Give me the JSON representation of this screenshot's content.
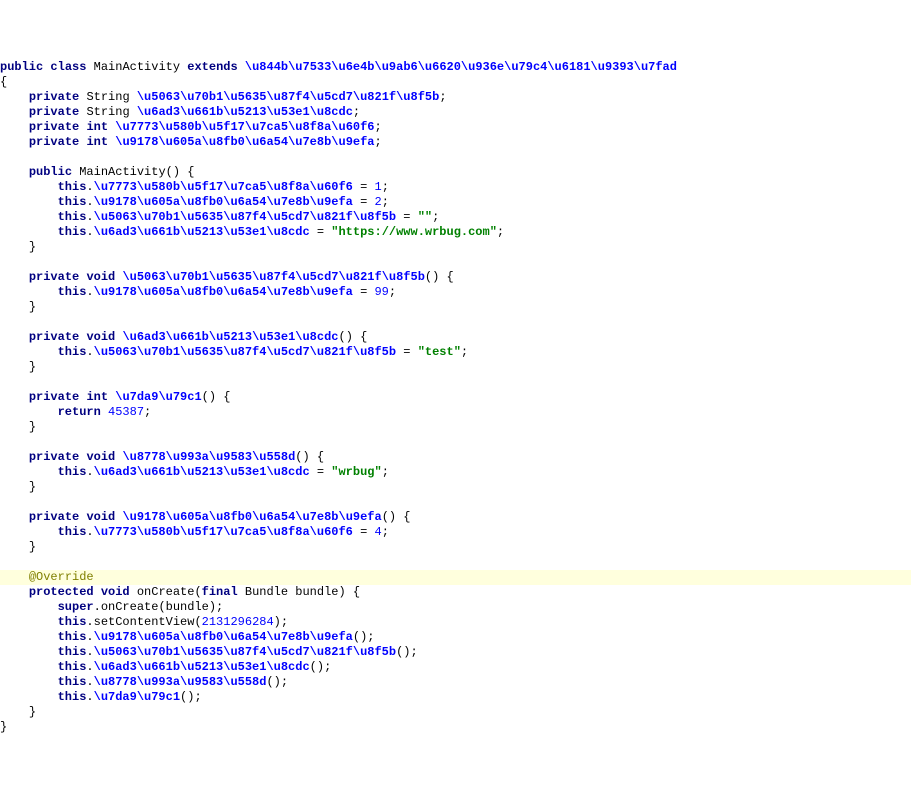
{
  "code": {
    "l1": {
      "kw1": "public",
      "kw2": "class",
      "name": "MainActivity",
      "kw3": "extends",
      "ext": "\\u844b\\u7533\\u6e4b\\u9ab6\\u6620\\u936e\\u79c4\\u6181\\u9393\\u7fad"
    },
    "l2": {
      "text": "{"
    },
    "l3": {
      "kw1": "private",
      "type": "String",
      "id": "\\u5063\\u70b1\\u5635\\u87f4\\u5cd7\\u821f\\u8f5b"
    },
    "l4": {
      "kw1": "private",
      "type": "String",
      "id": "\\u6ad3\\u661b\\u5213\\u53e1\\u8cdc"
    },
    "l5": {
      "kw1": "private",
      "kw2": "int",
      "id": "\\u7773\\u580b\\u5f17\\u7ca5\\u8f8a\\u60f6"
    },
    "l6": {
      "kw1": "private",
      "kw2": "int",
      "id": "\\u9178\\u605a\\u8fb0\\u6a54\\u7e8b\\u9efa"
    },
    "l8": {
      "kw1": "public",
      "name": "MainActivity",
      "suffix": "() {"
    },
    "l9": {
      "kw1": "this",
      "dot": ".",
      "id": "\\u7773\\u580b\\u5f17\\u7ca5\\u8f8a\\u60f6",
      "eq": " = ",
      "val": "1",
      "semi": ";"
    },
    "l10": {
      "kw1": "this",
      "dot": ".",
      "id": "\\u9178\\u605a\\u8fb0\\u6a54\\u7e8b\\u9efa",
      "eq": " = ",
      "val": "2",
      "semi": ";"
    },
    "l11": {
      "kw1": "this",
      "dot": ".",
      "id": "\\u5063\\u70b1\\u5635\\u87f4\\u5cd7\\u821f\\u8f5b",
      "eq": " = ",
      "val": "\"\"",
      "semi": ";"
    },
    "l12": {
      "kw1": "this",
      "dot": ".",
      "id": "\\u6ad3\\u661b\\u5213\\u53e1\\u8cdc",
      "eq": " = ",
      "val": "\"https://www.wrbug.com\"",
      "semi": ";"
    },
    "l13": {
      "text": "}"
    },
    "l15": {
      "kw1": "private",
      "kw2": "void",
      "id": "\\u5063\\u70b1\\u5635\\u87f4\\u5cd7\\u821f\\u8f5b",
      "suffix": "() {"
    },
    "l16": {
      "kw1": "this",
      "dot": ".",
      "id": "\\u9178\\u605a\\u8fb0\\u6a54\\u7e8b\\u9efa",
      "eq": " = ",
      "val": "99",
      "semi": ";"
    },
    "l17": {
      "text": "}"
    },
    "l19": {
      "kw1": "private",
      "kw2": "void",
      "id": "\\u6ad3\\u661b\\u5213\\u53e1\\u8cdc",
      "suffix": "() {"
    },
    "l20": {
      "kw1": "this",
      "dot": ".",
      "id": "\\u5063\\u70b1\\u5635\\u87f4\\u5cd7\\u821f\\u8f5b",
      "eq": " = ",
      "val": "\"test\"",
      "semi": ";"
    },
    "l21": {
      "text": "}"
    },
    "l23": {
      "kw1": "private",
      "kw2": "int",
      "id": "\\u7da9\\u79c1",
      "suffix": "() {"
    },
    "l24": {
      "kw1": "return",
      "val": "45387",
      "semi": ";"
    },
    "l25": {
      "text": "}"
    },
    "l27": {
      "kw1": "private",
      "kw2": "void",
      "id": "\\u8778\\u993a\\u9583\\u558d",
      "suffix": "() {"
    },
    "l28": {
      "kw1": "this",
      "dot": ".",
      "id": "\\u6ad3\\u661b\\u5213\\u53e1\\u8cdc",
      "eq": " = ",
      "val": "\"wrbug\"",
      "semi": ";"
    },
    "l29": {
      "text": "}"
    },
    "l31": {
      "kw1": "private",
      "kw2": "void",
      "id": "\\u9178\\u605a\\u8fb0\\u6a54\\u7e8b\\u9efa",
      "suffix": "() {"
    },
    "l32": {
      "kw1": "this",
      "dot": ".",
      "id": "\\u7773\\u580b\\u5f17\\u7ca5\\u8f8a\\u60f6",
      "eq": " = ",
      "val": "4",
      "semi": ";"
    },
    "l33": {
      "text": "}"
    },
    "l35": {
      "anno": "@Override"
    },
    "l36": {
      "kw1": "protected",
      "kw2": "void",
      "name": "onCreate(",
      "kw3": "final",
      "rest": " Bundle bundle) {"
    },
    "l37": {
      "kw1": "super",
      "dot": ".",
      "rest": "onCreate(bundle);"
    },
    "l38": {
      "kw1": "this",
      "dot": ".",
      "name": "setContentView(",
      "val": "2131296284",
      "rest": ");"
    },
    "l39": {
      "kw1": "this",
      "dot": ".",
      "id": "\\u9178\\u605a\\u8fb0\\u6a54\\u7e8b\\u9efa",
      "rest": "();"
    },
    "l40": {
      "kw1": "this",
      "dot": ".",
      "id": "\\u5063\\u70b1\\u5635\\u87f4\\u5cd7\\u821f\\u8f5b",
      "rest": "();"
    },
    "l41": {
      "kw1": "this",
      "dot": ".",
      "id": "\\u6ad3\\u661b\\u5213\\u53e1\\u8cdc",
      "rest": "();"
    },
    "l42": {
      "kw1": "this",
      "dot": ".",
      "id": "\\u8778\\u993a\\u9583\\u558d",
      "rest": "();"
    },
    "l43": {
      "kw1": "this",
      "dot": ".",
      "id": "\\u7da9\\u79c1",
      "rest": "();"
    },
    "l44": {
      "text": "}"
    },
    "l45": {
      "text": "}"
    }
  }
}
